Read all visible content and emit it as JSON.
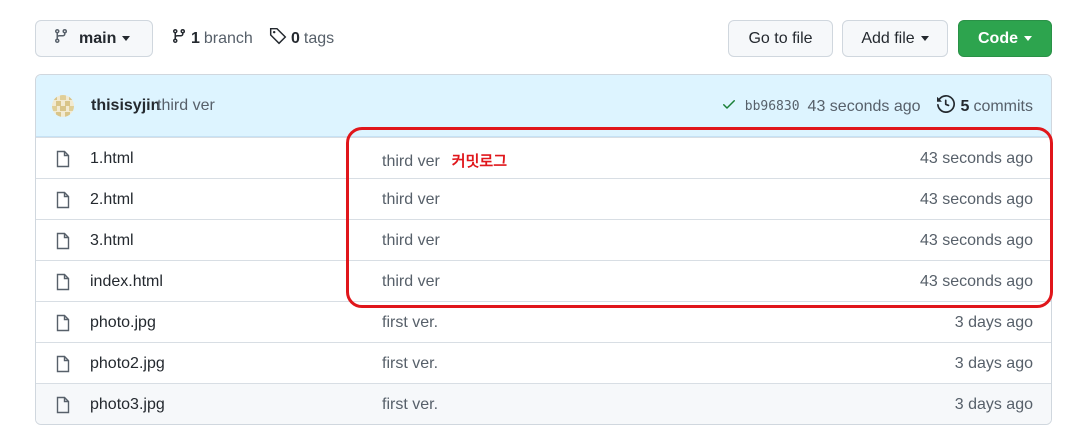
{
  "toolbar": {
    "branch_label": "main",
    "branch_count": "1",
    "branch_word": "branch",
    "tag_count": "0",
    "tag_word": "tags",
    "goto_file": "Go to file",
    "add_file": "Add file",
    "code": "Code"
  },
  "commit": {
    "author": "thisisyjin",
    "message": "third ver",
    "sha": "bb96830",
    "time": "43 seconds ago",
    "commit_count": "5",
    "commit_word": "commits"
  },
  "files": [
    {
      "name": "1.html",
      "message": "third ver",
      "time": "43 seconds ago"
    },
    {
      "name": "2.html",
      "message": "third ver",
      "time": "43 seconds ago"
    },
    {
      "name": "3.html",
      "message": "third ver",
      "time": "43 seconds ago"
    },
    {
      "name": "index.html",
      "message": "third ver",
      "time": "43 seconds ago"
    },
    {
      "name": "photo.jpg",
      "message": "first ver.",
      "time": "3 days ago"
    },
    {
      "name": "photo2.jpg",
      "message": "first ver.",
      "time": "3 days ago"
    },
    {
      "name": "photo3.jpg",
      "message": "first ver.",
      "time": "3 days ago"
    }
  ],
  "annotation": {
    "label": "커밋로그",
    "color": "#e0161b"
  },
  "colors": {
    "accent_green": "#2da44e",
    "commit_bar_bg": "#ddf4ff",
    "check_green": "#1a7f37"
  }
}
